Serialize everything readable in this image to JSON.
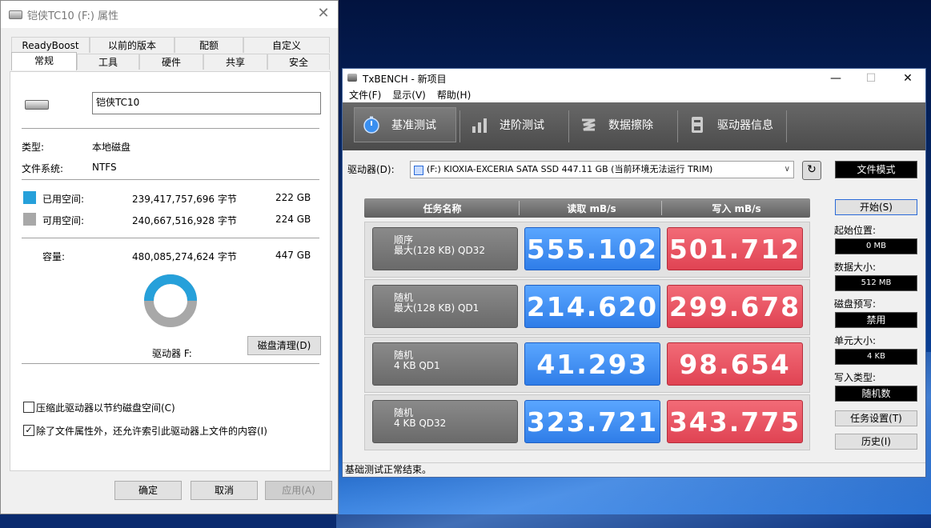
{
  "props": {
    "title": "铠侠TC10 (F:) 属性",
    "tabs_row1": [
      "ReadyBoost",
      "以前的版本",
      "配额",
      "自定义"
    ],
    "tabs_row2": [
      "常规",
      "工具",
      "硬件",
      "共享",
      "安全"
    ],
    "drive_name": "铠侠TC10",
    "type_label": "类型:",
    "type_value": "本地磁盘",
    "fs_label": "文件系统:",
    "fs_value": "NTFS",
    "used_label": "已用空间:",
    "used_bytes": "239,417,757,696 字节",
    "used_gb": "222 GB",
    "free_label": "可用空间:",
    "free_bytes": "240,667,516,928 字节",
    "free_gb": "224 GB",
    "cap_label": "容量:",
    "cap_bytes": "480,085,274,624 字节",
    "cap_gb": "447 GB",
    "drive_label": "驱动器 F:",
    "cleanup_button": "磁盘清理(D)",
    "compress_label": "压缩此驱动器以节约磁盘空间(C)",
    "compress_checked": false,
    "index_label": "除了文件属性外，还允许索引此驱动器上文件的内容(I)",
    "index_checked": true,
    "ok_button": "确定",
    "cancel_button": "取消",
    "apply_button": "应用(A)",
    "used_color": "#26a0da",
    "free_color": "#a8a8a8",
    "used_fraction": 0.4987
  },
  "tx": {
    "title": "TxBENCH - 新项目",
    "menu": [
      "文件(F)",
      "显示(V)",
      "帮助(H)"
    ],
    "toolbar": [
      "基准测试",
      "进阶测试",
      "数据擦除",
      "驱动器信息"
    ],
    "drive_label": "驱动器(D):",
    "drive_value": "(F:) KIOXIA-EXCERIA SATA SSD  447.11 GB (当前环境无法运行 TRIM)",
    "file_mode": "文件模式",
    "start_button": "开始(S)",
    "start_pos_label": "起始位置:",
    "start_pos_value": "0 MB",
    "data_size_label": "数据大小:",
    "data_size_value": "512 MB",
    "precond_label": "磁盘预写:",
    "precond_value": "禁用",
    "unit_label": "单元大小:",
    "unit_value": "4 KB",
    "write_type_label": "写入类型:",
    "write_type_value": "随机数",
    "task_settings_button": "任务设置(T)",
    "history_button": "历史(I)",
    "col_task": "任务名称",
    "col_read": "读取 mB/s",
    "col_write": "写入 mB/s",
    "rows": [
      {
        "line1": "顺序",
        "line2": "最大(128 KB) QD32",
        "read": "555.102",
        "write": "501.712"
      },
      {
        "line1": "随机",
        "line2": "最大(128 KB) QD1",
        "read": "214.620",
        "write": "299.678"
      },
      {
        "line1": "随机",
        "line2": "4 KB QD1",
        "read": "41.293",
        "write": "98.654"
      },
      {
        "line1": "随机",
        "line2": "4 KB QD32",
        "read": "323.721",
        "write": "343.775"
      }
    ],
    "status": "基础测试正常结束。"
  }
}
